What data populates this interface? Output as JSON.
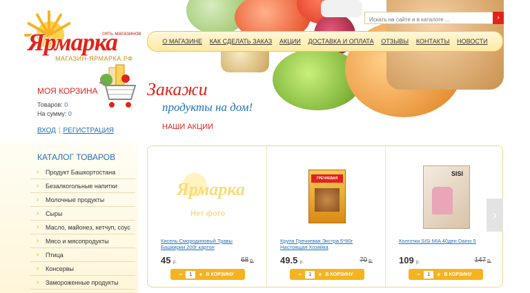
{
  "logo": {
    "name": "Ярмарка",
    "tagline": "сеть магазинов",
    "domain": "МАГАЗИН-ЯРМАРКА.РФ"
  },
  "search": {
    "placeholder": "Искать на сайте и в каталоге ...",
    "button_icon": "chevron-right-icon"
  },
  "nav": {
    "items": [
      "О МАГАЗИНЕ",
      "КАК СДЕЛАТЬ ЗАКАЗ",
      "АКЦИИ",
      "ДОСТАВКА И ОПЛАТА",
      "ОТЗЫВЫ",
      "КОНТАКТЫ",
      "НОВОСТИ"
    ]
  },
  "basket": {
    "title": "МОЯ КОРЗИНА",
    "items_label": "Товаров:",
    "items_value": "0",
    "sum_label": "На сумму:",
    "sum_value": "0"
  },
  "auth": {
    "login": "ВХОД",
    "separator": "|",
    "register": "РЕГИСТРАЦИЯ"
  },
  "slogan": {
    "line1": "Закажи",
    "line2": "продукты на дом!"
  },
  "promo_title": "НАШИ АКЦИИ",
  "catalog": {
    "title": "КАТАЛОГ ТОВАРОВ",
    "items": [
      "Продукт Башкортостана",
      "Безалкогольные напитки",
      "Молочные продукты",
      "Сыры",
      "Масло, майонез, кетчуп, соус",
      "Мясо и мясопродукты",
      "Птица",
      "Консервы",
      "Замороженные продукты"
    ]
  },
  "products": [
    {
      "image_text": "Ярмарка",
      "no_photo": "Нет фото",
      "name": "Кисель Смородиновый Травы Башкирии 200г картон",
      "price": "45",
      "currency": "р.",
      "old_price": "68",
      "qty": "1",
      "buy_label": "В КОРЗИНУ"
    },
    {
      "image_text": "ГРЕЧНЕВАЯ",
      "no_photo": "",
      "name": "Крупа Гречневая Экстра 5*80г Настоящая Хозяйка",
      "price": "49.5",
      "currency": "р.",
      "old_price": "70",
      "qty": "1",
      "buy_label": "В КОРЗИНУ"
    },
    {
      "image_text": "SISI",
      "no_photo": "",
      "name": "Колготки SiSi MIA 40ден Daino 5",
      "price": "109",
      "currency": "р.",
      "old_price": "147",
      "qty": "1",
      "buy_label": "В КОРЗИНУ"
    }
  ],
  "controls": {
    "minus": "−",
    "plus": "+",
    "next": "›"
  },
  "colors": {
    "brand_red": "#e2231a",
    "link_blue": "#1f6fb5",
    "accent_yellow": "#f4b31f"
  }
}
